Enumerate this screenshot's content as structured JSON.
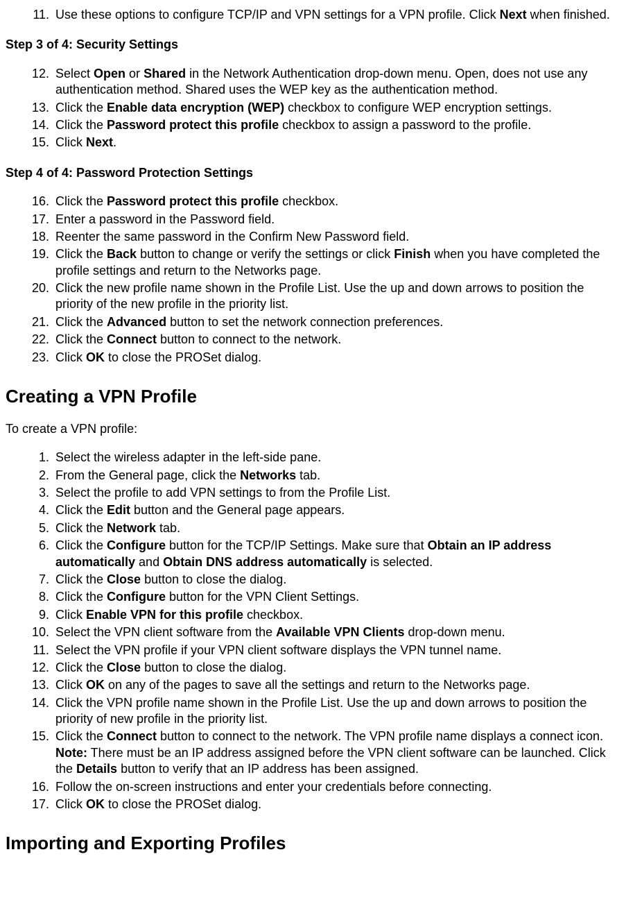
{
  "step11": {
    "pre": "Use these options to configure TCP/IP and VPN settings for a VPN profile. Click ",
    "b1": "Next",
    "post": " when finished."
  },
  "step3_heading": "Step 3 of 4: Security Settings",
  "s12": {
    "pre": "Select ",
    "b1": "Open",
    "mid1": " or ",
    "b2": "Shared",
    "post": " in the Network Authentication drop-down menu. Open, does not use any authentication method. Shared uses the WEP key as the authentication method."
  },
  "s13": {
    "pre": "Click the ",
    "b1": "Enable data encryption (WEP)",
    "post": " checkbox to configure WEP encryption settings."
  },
  "s14": {
    "pre": "Click the ",
    "b1": "Password protect this profile",
    "post": " checkbox to assign a password to the profile."
  },
  "s15": {
    "pre": "Click ",
    "b1": "Next",
    "post": "."
  },
  "step4_heading": "Step 4 of 4: Password Protection Settings",
  "s16": {
    "pre": "Click the ",
    "b1": "Password protect this profile",
    "post": " checkbox."
  },
  "s17": {
    "text": "Enter a password in the Password field."
  },
  "s18": {
    "text": "Reenter the same password in the Confirm New Password field."
  },
  "s19": {
    "pre": "Click the ",
    "b1": "Back",
    "mid1": " button to change or verify the settings or click ",
    "b2": "Finish",
    "post": " when you have completed the profile settings and return to the Networks page."
  },
  "s20": {
    "text": "Click the new profile name shown in the Profile List. Use the up and down arrows to position the priority of the new profile in the priority list."
  },
  "s21": {
    "pre": "Click the ",
    "b1": "Advanced",
    "post": " button to set the network connection preferences."
  },
  "s22": {
    "pre": "Click the ",
    "b1": "Connect",
    "post": " button to connect to the network."
  },
  "s23": {
    "pre": "Click ",
    "b1": "OK",
    "post": " to close the PROSet dialog."
  },
  "h2_vpn": "Creating a VPN Profile",
  "vpn_intro": "To create a VPN profile:",
  "v1": {
    "text": "Select the wireless adapter in the left-side pane."
  },
  "v2": {
    "pre": "From the General page, click the ",
    "b1": "Networks",
    "post": " tab."
  },
  "v3": {
    "text": "Select the profile to add VPN settings to from the Profile List."
  },
  "v4": {
    "pre": "Click the ",
    "b1": "Edit",
    "post": " button and the General page appears."
  },
  "v5": {
    "pre": "Click the ",
    "b1": "Network",
    "post": " tab."
  },
  "v6": {
    "pre": "Click the ",
    "b1": "Configure",
    "mid1": " button for the TCP/IP Settings. Make sure that ",
    "b2": "Obtain an IP address automatically",
    "mid2": " and ",
    "b3": "Obtain DNS address automatically",
    "post": " is selected."
  },
  "v7": {
    "pre": "Click the ",
    "b1": "Close",
    "post": " button to close the dialog."
  },
  "v8": {
    "pre": "Click the ",
    "b1": "Configure",
    "post": " button for the VPN Client Settings."
  },
  "v9": {
    "pre": "Click ",
    "b1": "Enable VPN for this profile",
    "post": " checkbox."
  },
  "v10": {
    "pre": "Select the VPN client software from the ",
    "b1": "Available VPN Clients",
    "post": " drop-down menu."
  },
  "v11": {
    "text": "Select the VPN profile if your VPN client software displays the VPN tunnel name."
  },
  "v12": {
    "pre": "Click the ",
    "b1": "Close",
    "post": " button to close the dialog."
  },
  "v13": {
    "pre": "Click ",
    "b1": "OK",
    "post": " on any of the pages to save all the settings and return to the Networks page."
  },
  "v14": {
    "text": "Click the VPN profile name shown in the Profile List. Use the up and down arrows to position the priority of new profile in the priority list."
  },
  "v15": {
    "pre": "Click the ",
    "b1": "Connect",
    "mid1": " button to connect to the network. The VPN profile name displays a connect icon. ",
    "b2": "Note:",
    "mid2": " There must be an IP address assigned before the VPN client software can be launched. Click the ",
    "b3": "Details",
    "post": " button to verify that an IP address has been assigned."
  },
  "v16": {
    "text": "Follow the on-screen instructions and enter your credentials before connecting."
  },
  "v17": {
    "pre": "Click ",
    "b1": "OK",
    "post": " to close the PROSet dialog."
  },
  "h2_import": "Importing and Exporting Profiles"
}
